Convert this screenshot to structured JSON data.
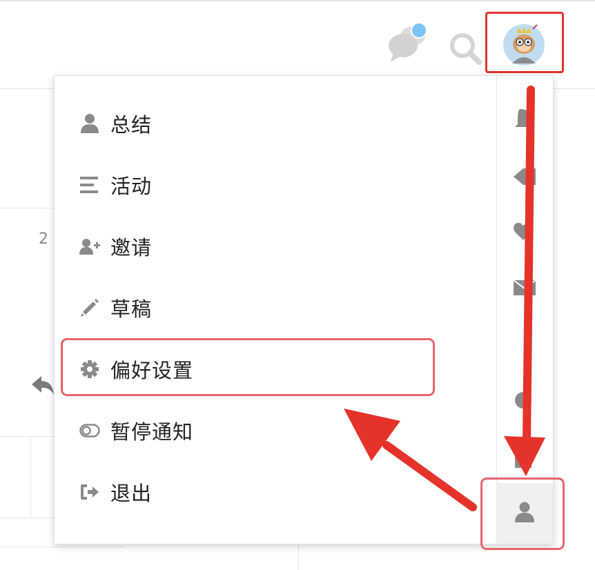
{
  "header": {
    "chat_icon": "chat-bubble-icon",
    "search_icon": "search-icon",
    "avatar": "avatar"
  },
  "background": {
    "partial_text": "2"
  },
  "user_menu": {
    "items": [
      {
        "icon": "user-icon",
        "label": "总结"
      },
      {
        "icon": "list-icon",
        "label": "活动"
      },
      {
        "icon": "user-plus-icon",
        "label": "邀请"
      },
      {
        "icon": "pencil-icon",
        "label": "草稿"
      },
      {
        "icon": "gear-icon",
        "label": "偏好设置"
      },
      {
        "icon": "toggle-icon",
        "label": "暂停通知"
      },
      {
        "icon": "sign-out-icon",
        "label": "退出"
      }
    ],
    "side_tabs": [
      "bell-icon",
      "tag-icon",
      "heart-icon",
      "envelope-icon",
      "circle-icon",
      "square-icon",
      "user-icon"
    ]
  },
  "colors": {
    "highlight_box": "#e8636b",
    "arrow": "#e5332a",
    "notification_dot": "#7dc3f5",
    "icon_gray": "#8a8a8a"
  }
}
